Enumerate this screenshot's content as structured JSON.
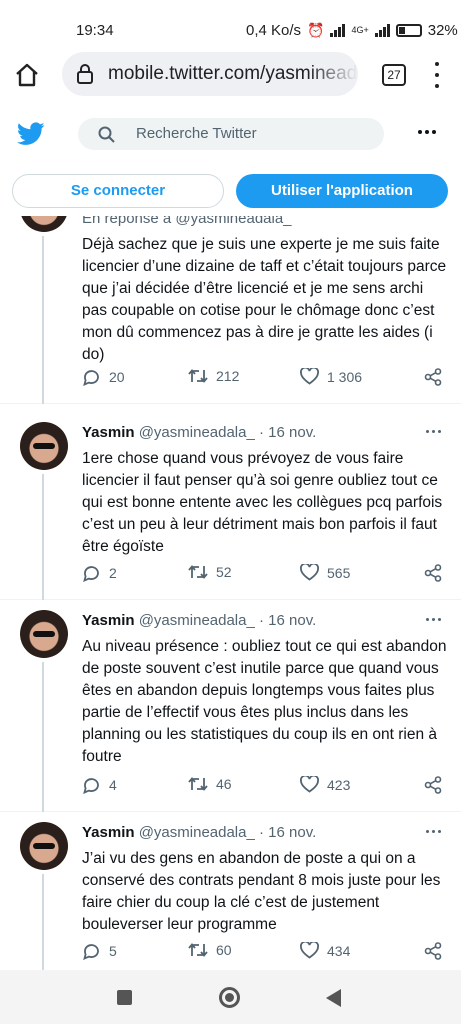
{
  "status_bar": {
    "time": "19:34",
    "speed": "0,4 Ko/s",
    "network": "4G+",
    "battery": "32%"
  },
  "browser": {
    "url": "mobile.twitter.com/yasmineadala",
    "tab_count": "27"
  },
  "header": {
    "search_placeholder": "Recherche Twitter"
  },
  "buttons": {
    "login": "Se connecter",
    "app": "Utiliser l'application"
  },
  "tweets": [
    {
      "reply_to": "En réponse à @yasmineadala_",
      "text": "Déjà sachez que je suis une experte je me suis faite licencier d’une dizaine de taff et c’était toujours parce que j’ai décidée d’être licencié et je me sens archi pas coupable on cotise pour le chômage donc c’est mon dû commencez pas à dire je gratte les aides (i do)",
      "replies": "20",
      "retweets": "212",
      "likes": "1 306"
    },
    {
      "name": "Yasmin",
      "handle": "@yasmineadala_",
      "date": "· 16 nov.",
      "text": "1ere chose quand vous prévoyez de vous faire licencier il faut penser qu’à soi genre oubliez tout ce qui est bonne entente avec les collègues pcq parfois c’est un peu à leur détriment mais bon parfois il faut être égoïste",
      "replies": "2",
      "retweets": "52",
      "likes": "565"
    },
    {
      "name": "Yasmin",
      "handle": "@yasmineadala_",
      "date": "· 16 nov.",
      "text": "Au niveau présence : oubliez tout ce qui est abandon de poste souvent c’est inutile parce que quand vous êtes en abandon depuis longtemps vous faites plus partie de l’effectif vous êtes plus inclus dans les planning ou les statistiques du coup ils en ont rien à foutre",
      "replies": "4",
      "retweets": "46",
      "likes": "423"
    },
    {
      "name": "Yasmin",
      "handle": "@yasmineadala_",
      "date": "· 16 nov.",
      "text": "J’ai vu des gens en abandon de poste a qui on a conservé des contrats pendant 8 mois juste pour les faire chier du coup la clé c’est de justement bouleverser leur programme",
      "replies": "5",
      "retweets": "60",
      "likes": "434"
    }
  ],
  "colors": {
    "accent": "#1d9bf0",
    "text": "#0f1419",
    "muted": "#536471"
  }
}
